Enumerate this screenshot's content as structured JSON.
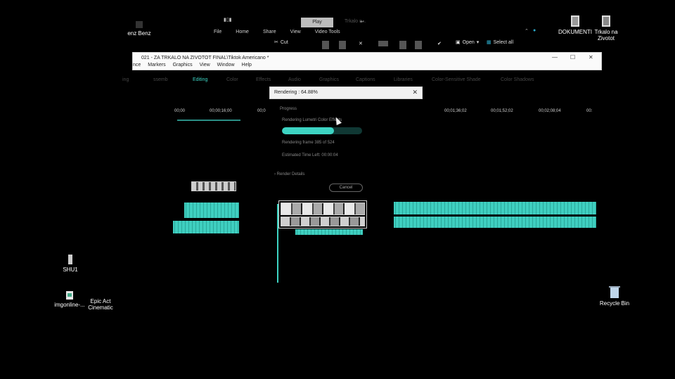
{
  "desktop": {
    "top_left_icon": "enz Benz",
    "shu_icon": "SHU1",
    "imgonline_icon": "imgonline-...",
    "epic_icon_line1": "Epic Act",
    "epic_icon_line2": "Cinematic",
    "dokumenti_icon": "DOKUMENTI",
    "trkalo_icon_line1": "Trkalo na",
    "trkalo_icon_line2": "Zivotot",
    "recycle_icon": "Recycle Bin"
  },
  "ribbon": {
    "play_tab": "Play",
    "context_label": "Trkalo n...",
    "tabs": [
      "File",
      "Home",
      "Share",
      "View",
      "Video Tools"
    ],
    "cut": "Cut",
    "open": "Open",
    "select_all": "Select all"
  },
  "editor": {
    "title": "021 - ZA TRKALO NA ZIVOTOT FINAL\\Tiktok Americano *",
    "menu": [
      "nce",
      "Markers",
      "Graphics",
      "View",
      "Window",
      "Help"
    ],
    "tabs": [
      "ing",
      "ssemb",
      "Editing",
      "Color",
      "Effects",
      "Audio",
      "Graphics",
      "Captions",
      "Libraries",
      "Color-Sensitive Shade",
      "Color Shadows"
    ],
    "active_tab": "Editing",
    "ruler": [
      "00;00",
      "00;00;16;00",
      "00;0",
      "00;01;36;02",
      "00;01;52;02",
      "00;02;08;04",
      "00:"
    ]
  },
  "render_dialog": {
    "title": "Rendering : 64.88%",
    "progress_header": "Progress",
    "rendering_label": "Rendering Lumetri Color Effects",
    "progress": 0.6488,
    "frame_text": "Rendering frame 385 of 524",
    "time_left": "Estimated Time Left: 00:00:04",
    "render_details": "Render Details",
    "cancel": "Cancel"
  },
  "colors": {
    "accent": "#3dd3c2",
    "background": "#000000"
  }
}
